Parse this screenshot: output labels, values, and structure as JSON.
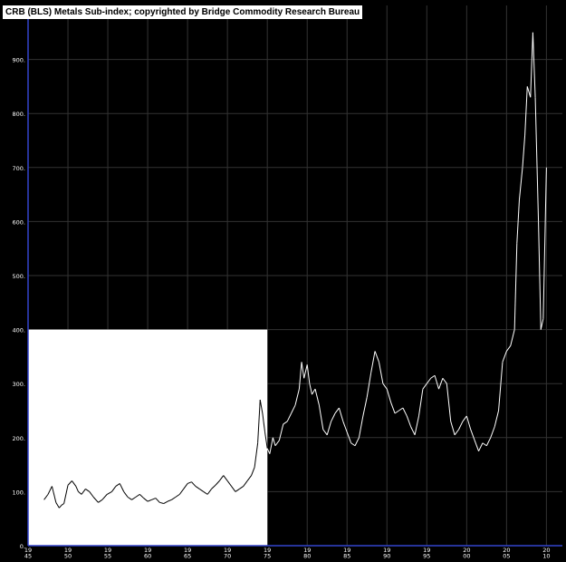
{
  "chart_data": {
    "type": "line",
    "title": "CRB (BLS) Metals Sub-index; copyrighted by Bridge Commodity Research Bureau",
    "xlabel": "",
    "ylabel": "",
    "ylim": [
      0,
      1000
    ],
    "xlim": [
      1945,
      2012
    ],
    "grid": true,
    "y_ticks": [
      "0.",
      "100.",
      "200.",
      "300.",
      "400.",
      "500.",
      "600.",
      "700.",
      "800.",
      "900."
    ],
    "x_ticks": [
      {
        "year": 1945,
        "top": "19",
        "bottom": "45"
      },
      {
        "year": 1950,
        "top": "19",
        "bottom": "50"
      },
      {
        "year": 1955,
        "top": "19",
        "bottom": "55"
      },
      {
        "year": 1960,
        "top": "19",
        "bottom": "60"
      },
      {
        "year": 1965,
        "top": "19",
        "bottom": "65"
      },
      {
        "year": 1970,
        "top": "19",
        "bottom": "70"
      },
      {
        "year": 1975,
        "top": "19",
        "bottom": "75"
      },
      {
        "year": 1980,
        "top": "19",
        "bottom": "80"
      },
      {
        "year": 1985,
        "top": "19",
        "bottom": "85"
      },
      {
        "year": 1990,
        "top": "19",
        "bottom": "90"
      },
      {
        "year": 1995,
        "top": "19",
        "bottom": "95"
      },
      {
        "year": 2000,
        "top": "20",
        "bottom": "00"
      },
      {
        "year": 2005,
        "top": "20",
        "bottom": "05"
      },
      {
        "year": 2010,
        "top": "20",
        "bottom": "10"
      }
    ],
    "highlight_region": {
      "x": [
        1945,
        1975
      ],
      "y": [
        0,
        400
      ],
      "color": "#ffffff"
    },
    "series": [
      {
        "color_on_white": "#000000",
        "color_on_black": "#ffffff",
        "x": [
          1947.0,
          1947.5,
          1948.0,
          1948.5,
          1948.9,
          1949.2,
          1949.5,
          1950.0,
          1950.5,
          1951.0,
          1951.3,
          1951.7,
          1952.2,
          1952.7,
          1953.2,
          1953.8,
          1954.3,
          1954.9,
          1955.5,
          1956.0,
          1956.5,
          1957.0,
          1957.5,
          1958.0,
          1958.5,
          1959.0,
          1959.5,
          1960.0,
          1960.5,
          1961.0,
          1961.5,
          1962.0,
          1962.5,
          1963.0,
          1963.5,
          1964.0,
          1964.5,
          1965.0,
          1965.5,
          1966.0,
          1966.5,
          1967.0,
          1967.5,
          1968.0,
          1968.5,
          1969.0,
          1969.5,
          1970.0,
          1970.5,
          1971.0,
          1971.5,
          1972.0,
          1972.5,
          1973.0,
          1973.4,
          1973.8,
          1974.1,
          1974.4,
          1974.7,
          1975.0,
          1975.3,
          1975.7,
          1976.0,
          1976.5,
          1977.0,
          1977.5,
          1978.0,
          1978.5,
          1979.0,
          1979.3,
          1979.6,
          1980.0,
          1980.3,
          1980.6,
          1981.0,
          1981.5,
          1982.0,
          1982.5,
          1983.0,
          1983.5,
          1984.0,
          1984.5,
          1985.0,
          1985.5,
          1986.0,
          1986.5,
          1987.0,
          1987.5,
          1988.0,
          1988.5,
          1989.0,
          1989.5,
          1990.0,
          1990.5,
          1991.0,
          1991.5,
          1992.0,
          1992.5,
          1993.0,
          1993.5,
          1994.0,
          1994.5,
          1995.0,
          1995.5,
          1996.0,
          1996.5,
          1997.0,
          1997.5,
          1998.0,
          1998.5,
          1999.0,
          1999.5,
          2000.0,
          2000.5,
          2001.0,
          2001.5,
          2002.0,
          2002.5,
          2003.0,
          2003.5,
          2004.0,
          2004.5,
          2005.0,
          2005.5,
          2006.0,
          2006.3,
          2006.6,
          2007.0,
          2007.3,
          2007.6,
          2008.0,
          2008.3,
          2008.6,
          2009.0,
          2009.3,
          2009.6,
          2010.0
        ],
        "y": [
          85,
          95,
          110,
          80,
          70,
          75,
          78,
          112,
          120,
          110,
          100,
          95,
          105,
          100,
          90,
          80,
          85,
          95,
          100,
          110,
          115,
          100,
          90,
          85,
          90,
          95,
          88,
          82,
          85,
          88,
          80,
          78,
          82,
          85,
          90,
          95,
          105,
          115,
          118,
          110,
          105,
          100,
          95,
          105,
          112,
          120,
          130,
          120,
          110,
          100,
          105,
          110,
          120,
          130,
          145,
          190,
          270,
          245,
          210,
          180,
          170,
          200,
          185,
          195,
          225,
          230,
          245,
          260,
          290,
          340,
          310,
          335,
          300,
          280,
          290,
          260,
          215,
          205,
          230,
          245,
          255,
          230,
          210,
          190,
          185,
          200,
          240,
          275,
          320,
          360,
          340,
          300,
          290,
          265,
          245,
          250,
          255,
          240,
          220,
          205,
          240,
          290,
          300,
          310,
          315,
          290,
          310,
          300,
          230,
          205,
          215,
          230,
          240,
          215,
          195,
          175,
          190,
          185,
          200,
          220,
          250,
          340,
          360,
          370,
          400,
          560,
          640,
          700,
          760,
          850,
          830,
          950,
          830,
          600,
          400,
          420,
          700
        ]
      }
    ]
  }
}
